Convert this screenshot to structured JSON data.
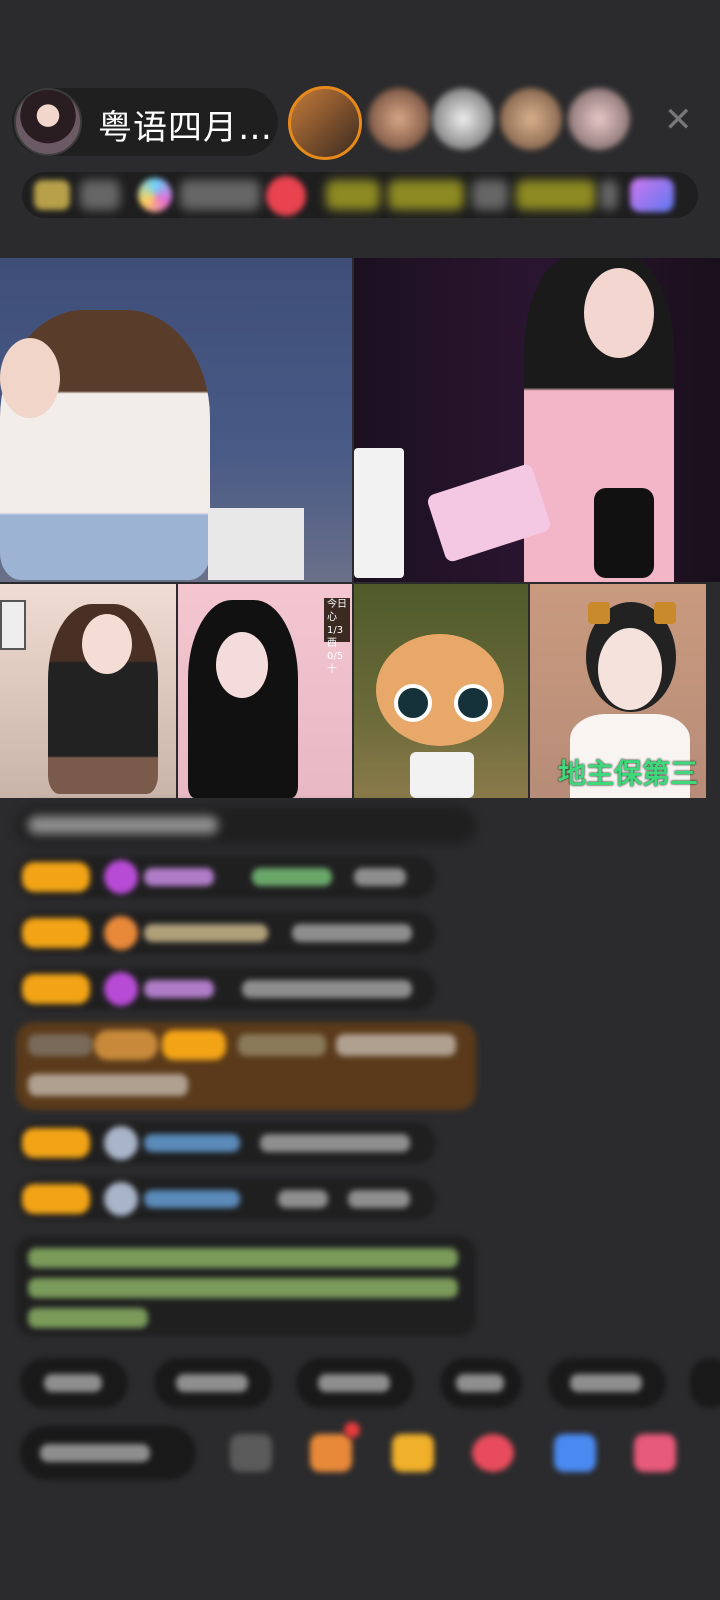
{
  "header": {
    "host_name": "粤语四月…",
    "close_label": "✕"
  },
  "video_grid": {
    "tile_label": "地主保第三",
    "overlay_text": "今日心 1/3西 0/5十"
  },
  "colors": {
    "background": "#2b2b2d",
    "gift_badge": "#f3a416",
    "label_green": "#3fd87a"
  }
}
